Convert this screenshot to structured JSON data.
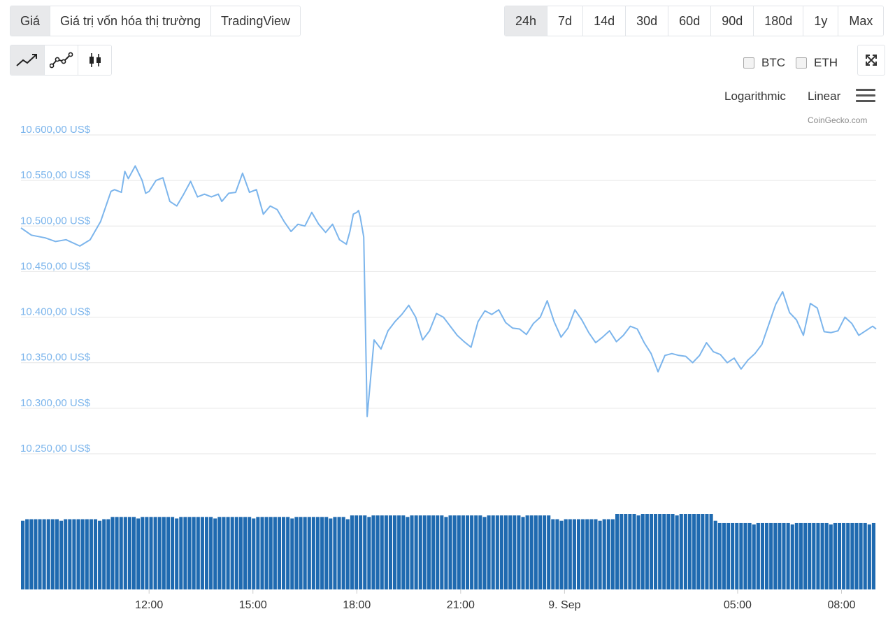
{
  "view_tabs": [
    "Giá",
    "Giá trị vốn hóa thị trường",
    "TradingView"
  ],
  "range_tabs": [
    "24h",
    "7d",
    "14d",
    "30d",
    "60d",
    "90d",
    "180d",
    "1y",
    "Max"
  ],
  "chart_type_buttons": [
    "line-chart-icon",
    "point-line-chart-icon",
    "candlestick-icon"
  ],
  "compare": {
    "btc_label": "BTC",
    "eth_label": "ETH"
  },
  "scale": {
    "log_label": "Logarithmic",
    "linear_label": "Linear"
  },
  "credit": "CoinGecko.com",
  "colors": {
    "line": "#7cb5ec",
    "volume": "#1f6ab0",
    "grid": "#e6e6e6",
    "ytick": "#7cb5ec"
  },
  "chart_data": {
    "type": "line",
    "y_tick_labels": [
      "10.600,00 US$",
      "10.550,00 US$",
      "10.500,00 US$",
      "10.450,00 US$",
      "10.400,00 US$",
      "10.350,00 US$",
      "10.300,00 US$",
      "10.250,00 US$"
    ],
    "y_ticks": [
      10600,
      10550,
      10500,
      10450,
      10400,
      10350,
      10300,
      10250
    ],
    "ylim": [
      10250,
      10600
    ],
    "x_tick_labels": [
      "12:00",
      "15:00",
      "18:00",
      "21:00",
      "9. Sep",
      "05:00",
      "08:00"
    ],
    "x_ticks_hours": [
      12,
      15,
      18,
      21,
      24,
      29,
      32
    ],
    "xlim_hours": [
      8.3,
      33.0
    ],
    "grid": true,
    "series": [
      {
        "x_hours": [
          8.3,
          8.6,
          9.0,
          9.3,
          9.6,
          10.0,
          10.3,
          10.6,
          10.9,
          11.0,
          11.2,
          11.3,
          11.4,
          11.6,
          11.8,
          11.9,
          12.0,
          12.2,
          12.4,
          12.6,
          12.8,
          13.0,
          13.2,
          13.4,
          13.6,
          13.8,
          14.0,
          14.1,
          14.3,
          14.5,
          14.7,
          14.9,
          15.1,
          15.3,
          15.5,
          15.7,
          15.9,
          16.1,
          16.3,
          16.5,
          16.7,
          16.9,
          17.1,
          17.3,
          17.5,
          17.7,
          17.8,
          17.9,
          18.0,
          18.05,
          18.1,
          18.2,
          18.3,
          18.5,
          18.7,
          18.9,
          19.1,
          19.3,
          19.5,
          19.7,
          19.9,
          20.1,
          20.3,
          20.5,
          20.7,
          20.9,
          21.1,
          21.3,
          21.5,
          21.7,
          21.9,
          22.1,
          22.3,
          22.5,
          22.7,
          22.9,
          23.1,
          23.3,
          23.5,
          23.7,
          23.9,
          24.1,
          24.3,
          24.5,
          24.7,
          24.9,
          25.1,
          25.3,
          25.5,
          25.7,
          25.9,
          26.1,
          26.3,
          26.5,
          26.7,
          26.9,
          27.1,
          27.3,
          27.5,
          27.7,
          27.9,
          28.1,
          28.3,
          28.5,
          28.7,
          28.9,
          29.1,
          29.3,
          29.5,
          29.7,
          29.9,
          30.1,
          30.3,
          30.5,
          30.7,
          30.9,
          31.1,
          31.3,
          31.5,
          31.7,
          31.9,
          32.1,
          32.3,
          32.5,
          32.7,
          32.9,
          33.0
        ],
        "y": [
          10498,
          10490,
          10487,
          10483,
          10485,
          10478,
          10485,
          10505,
          10538,
          10540,
          10537,
          10560,
          10552,
          10566,
          10550,
          10536,
          10538,
          10550,
          10553,
          10527,
          10522,
          10535,
          10549,
          10532,
          10535,
          10532,
          10535,
          10527,
          10536,
          10537,
          10558,
          10537,
          10540,
          10513,
          10522,
          10518,
          10505,
          10494,
          10502,
          10500,
          10515,
          10502,
          10493,
          10502,
          10485,
          10480,
          10494,
          10513,
          10515,
          10517,
          10510,
          10488,
          10291,
          10375,
          10365,
          10385,
          10395,
          10403,
          10413,
          10400,
          10375,
          10385,
          10404,
          10400,
          10390,
          10380,
          10373,
          10367,
          10395,
          10407,
          10403,
          10408,
          10394,
          10388,
          10387,
          10381,
          10393,
          10400,
          10418,
          10395,
          10378,
          10388,
          10408,
          10397,
          10383,
          10372,
          10378,
          10385,
          10373,
          10380,
          10390,
          10387,
          10372,
          10360,
          10340,
          10358,
          10360,
          10358,
          10357,
          10350,
          10358,
          10372,
          10362,
          10359,
          10350,
          10355,
          10343,
          10353,
          10360,
          10370,
          10392,
          10414,
          10428,
          10405,
          10397,
          10380,
          10415,
          10410,
          10384,
          10383,
          10385,
          10400,
          10393,
          10380,
          10385,
          10390,
          10387
        ]
      }
    ],
    "volume": {
      "x_hours_start": 8.3,
      "x_hours_end": 33.0,
      "bar_count": 200
    }
  }
}
